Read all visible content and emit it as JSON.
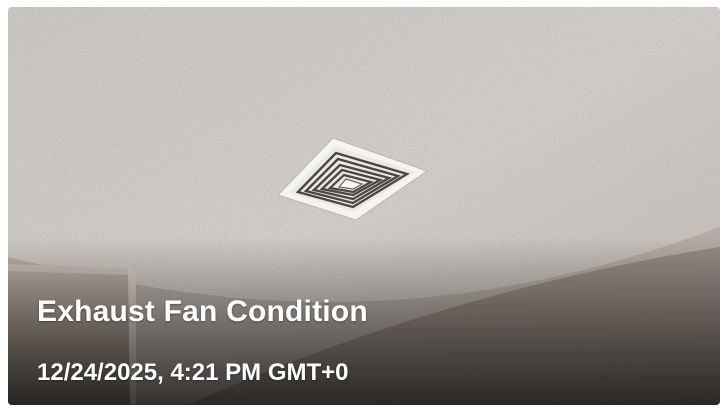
{
  "photo": {
    "icon": "exhaust-fan-ceiling-photo"
  },
  "caption": {
    "title": "Exhaust Fan Condition",
    "timestamp": "12/24/2025, 4:21 PM GMT+0"
  },
  "colors": {
    "ceiling": "#d9d3cd",
    "overlay": "#1e1e1e",
    "text": "#ffffff",
    "vent_frame": "#f4f3f2",
    "vent_slot": "#4a4744"
  }
}
